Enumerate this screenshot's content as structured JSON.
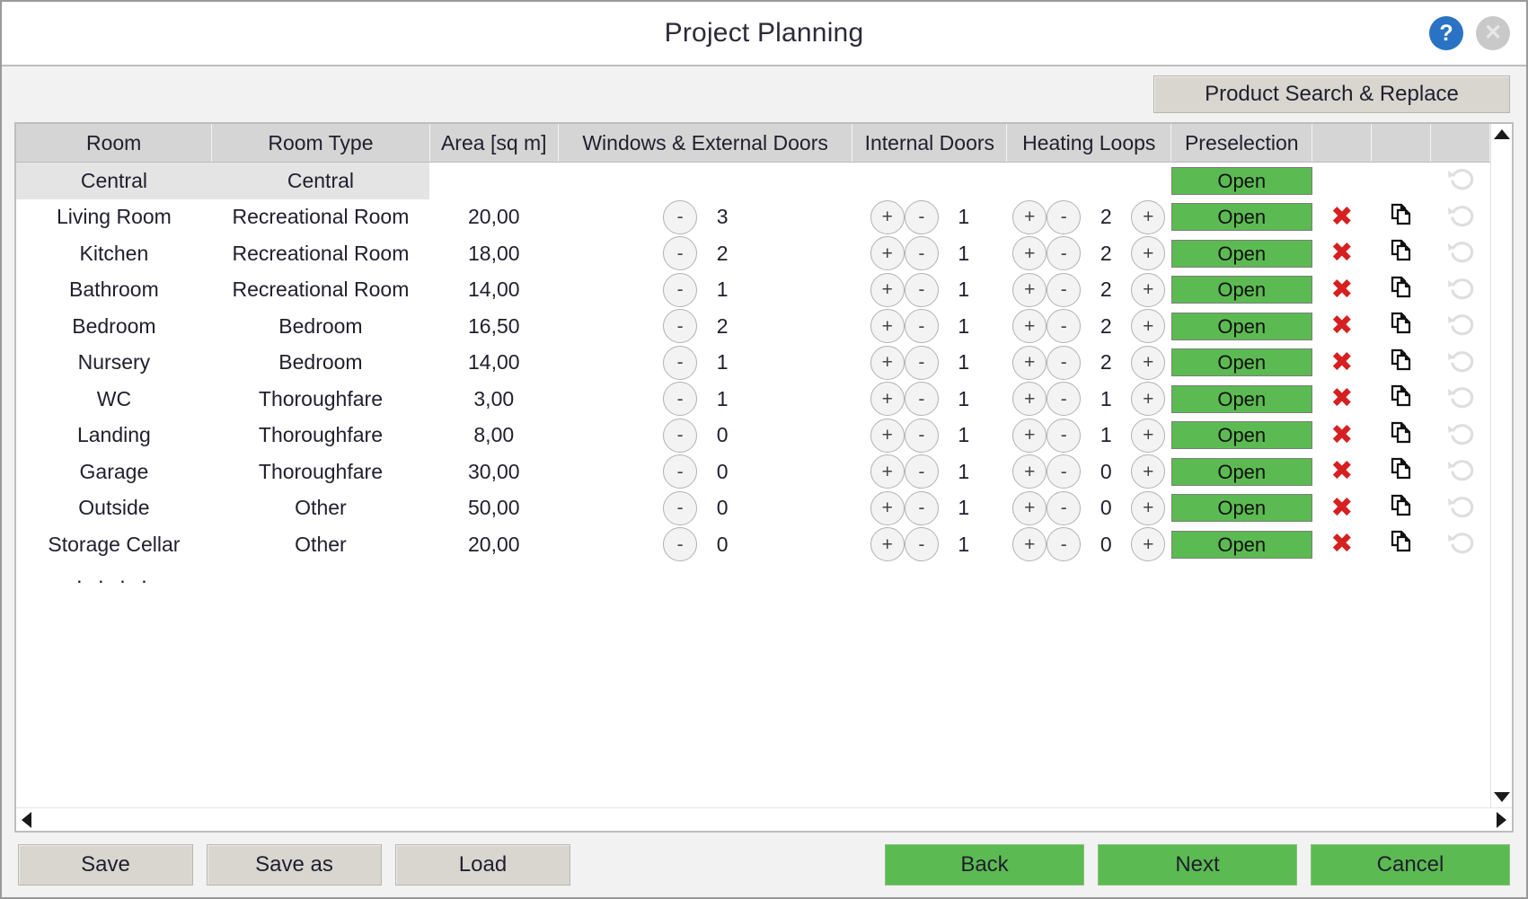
{
  "window": {
    "title": "Project Planning",
    "help_icon": "help-question-icon",
    "help_label": "?",
    "close_label": "✕"
  },
  "toolbar": {
    "product_search_replace": "Product Search & Replace"
  },
  "grid": {
    "columns": [
      "Room",
      "Room Type",
      "Area [sq m]",
      "Windows & External Doors",
      "Internal Doors",
      "Heating Loops",
      "Preselection",
      "",
      "",
      ""
    ],
    "open_label": "Open",
    "minus_label": "-",
    "plus_label": "+",
    "ellipsis_row": "· · · ·",
    "central_row": {
      "room": "Central",
      "room_type": "Central",
      "preselection": "Open"
    },
    "rows": [
      {
        "room": "Living Room",
        "room_type": "Recreational Room",
        "area": "20,00",
        "windows": "3",
        "internal_doors": "1",
        "heating_loops": "2",
        "preselection": "Open"
      },
      {
        "room": "Kitchen",
        "room_type": "Recreational Room",
        "area": "18,00",
        "windows": "2",
        "internal_doors": "1",
        "heating_loops": "2",
        "preselection": "Open"
      },
      {
        "room": "Bathroom",
        "room_type": "Recreational Room",
        "area": "14,00",
        "windows": "1",
        "internal_doors": "1",
        "heating_loops": "2",
        "preselection": "Open"
      },
      {
        "room": "Bedroom",
        "room_type": "Bedroom",
        "area": "16,50",
        "windows": "2",
        "internal_doors": "1",
        "heating_loops": "2",
        "preselection": "Open"
      },
      {
        "room": "Nursery",
        "room_type": "Bedroom",
        "area": "14,00",
        "windows": "1",
        "internal_doors": "1",
        "heating_loops": "2",
        "preselection": "Open"
      },
      {
        "room": "WC",
        "room_type": "Thoroughfare",
        "area": "3,00",
        "windows": "1",
        "internal_doors": "1",
        "heating_loops": "1",
        "preselection": "Open"
      },
      {
        "room": "Landing",
        "room_type": "Thoroughfare",
        "area": "8,00",
        "windows": "0",
        "internal_doors": "1",
        "heating_loops": "1",
        "preselection": "Open"
      },
      {
        "room": "Garage",
        "room_type": "Thoroughfare",
        "area": "30,00",
        "windows": "0",
        "internal_doors": "1",
        "heating_loops": "0",
        "preselection": "Open"
      },
      {
        "room": "Outside",
        "room_type": "Other",
        "area": "50,00",
        "windows": "0",
        "internal_doors": "1",
        "heating_loops": "0",
        "preselection": "Open"
      },
      {
        "room": "Storage Cellar",
        "room_type": "Other",
        "area": "20,00",
        "windows": "0",
        "internal_doors": "1",
        "heating_loops": "0",
        "preselection": "Open"
      }
    ]
  },
  "footer": {
    "save": "Save",
    "save_as": "Save as",
    "load": "Load",
    "back": "Back",
    "next": "Next",
    "cancel": "Cancel"
  },
  "colors": {
    "green": "#5cba52",
    "help_blue": "#2a72c4",
    "delete_red": "#d62020",
    "header_grey": "#d5d5d5"
  }
}
